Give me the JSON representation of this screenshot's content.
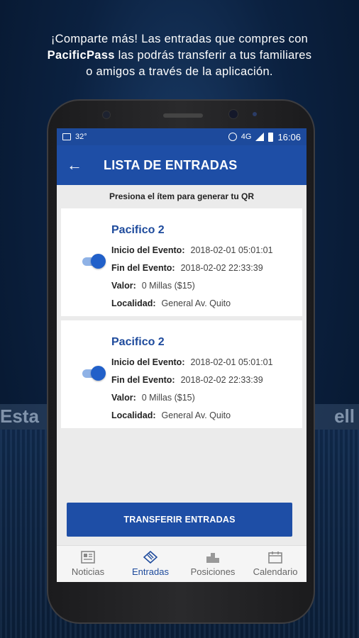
{
  "promo": {
    "line1": "¡Comparte más! Las entradas que compres con",
    "line2_bold": "PacificPass",
    "line2_rest": " las podrás transferir a tus familiares",
    "line3": "o amigos a través de la aplicación."
  },
  "background": {
    "sign_left": "Esta",
    "sign_right": "ell"
  },
  "status_bar": {
    "temperature": "32°",
    "network": "4G",
    "time": "16:06"
  },
  "app_bar": {
    "title": "LISTA DE ENTRADAS",
    "back_icon": "arrow-left-icon"
  },
  "hint": "Presiona el ítem para generar tu QR",
  "tickets": [
    {
      "name": "Pacifico 2",
      "inicio_label": "Inicio del Evento:",
      "inicio": "2018-02-01 05:01:01",
      "fin_label": "Fin del Evento:",
      "fin": "2018-02-02 22:33:39",
      "valor_label": "Valor:",
      "valor": "0 Millas ($15)",
      "localidad_label": "Localidad:",
      "localidad": "General Av. Quito",
      "toggle_on": true
    },
    {
      "name": "Pacifico 2",
      "inicio_label": "Inicio del Evento:",
      "inicio": "2018-02-01 05:01:01",
      "fin_label": "Fin del Evento:",
      "fin": "2018-02-02 22:33:39",
      "valor_label": "Valor:",
      "valor": "0 Millas ($15)",
      "localidad_label": "Localidad:",
      "localidad": "General Av. Quito",
      "toggle_on": true
    }
  ],
  "transfer_button": "TRANSFERIR ENTRADAS",
  "tabs": [
    {
      "label": "Noticias",
      "icon": "newspaper-icon",
      "active": false
    },
    {
      "label": "Entradas",
      "icon": "tickets-icon",
      "active": true
    },
    {
      "label": "Posiciones",
      "icon": "podium-icon",
      "active": false
    },
    {
      "label": "Calendario",
      "icon": "calendar-icon",
      "active": false
    }
  ],
  "colors": {
    "primary": "#1e4ea6",
    "status_bar": "#1d4a9c",
    "accent_text": "#1d4a9c",
    "screen_bg": "#ebebeb"
  }
}
